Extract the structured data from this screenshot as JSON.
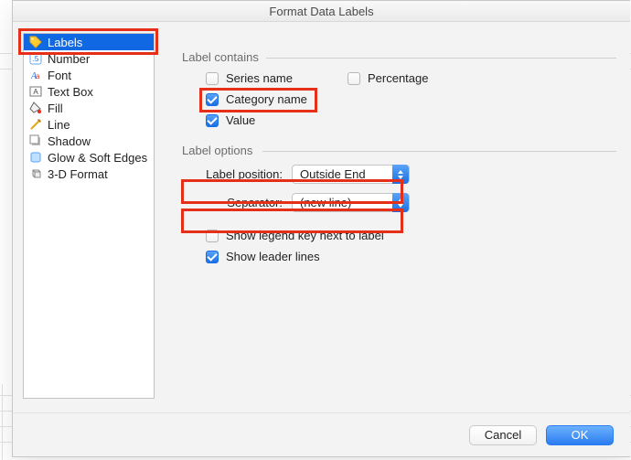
{
  "dialog": {
    "title": "Format Data Labels"
  },
  "sidebar": {
    "items": [
      {
        "label": "Labels"
      },
      {
        "label": "Number"
      },
      {
        "label": "Font"
      },
      {
        "label": "Text Box"
      },
      {
        "label": "Fill"
      },
      {
        "label": "Line"
      },
      {
        "label": "Shadow"
      },
      {
        "label": "Glow & Soft Edges"
      },
      {
        "label": "3-D Format"
      }
    ]
  },
  "contains": {
    "group_title": "Label contains",
    "series_name": "Series name",
    "percentage": "Percentage",
    "category_name": "Category name",
    "value": "Value"
  },
  "options": {
    "group_title": "Label options",
    "position_label": "Label position:",
    "position_value": "Outside End",
    "separator_label": "Separator:",
    "separator_value": "(new line)",
    "show_legend_key": "Show legend key next to label",
    "show_leader_lines": "Show leader lines"
  },
  "footer": {
    "cancel": "Cancel",
    "ok": "OK"
  }
}
